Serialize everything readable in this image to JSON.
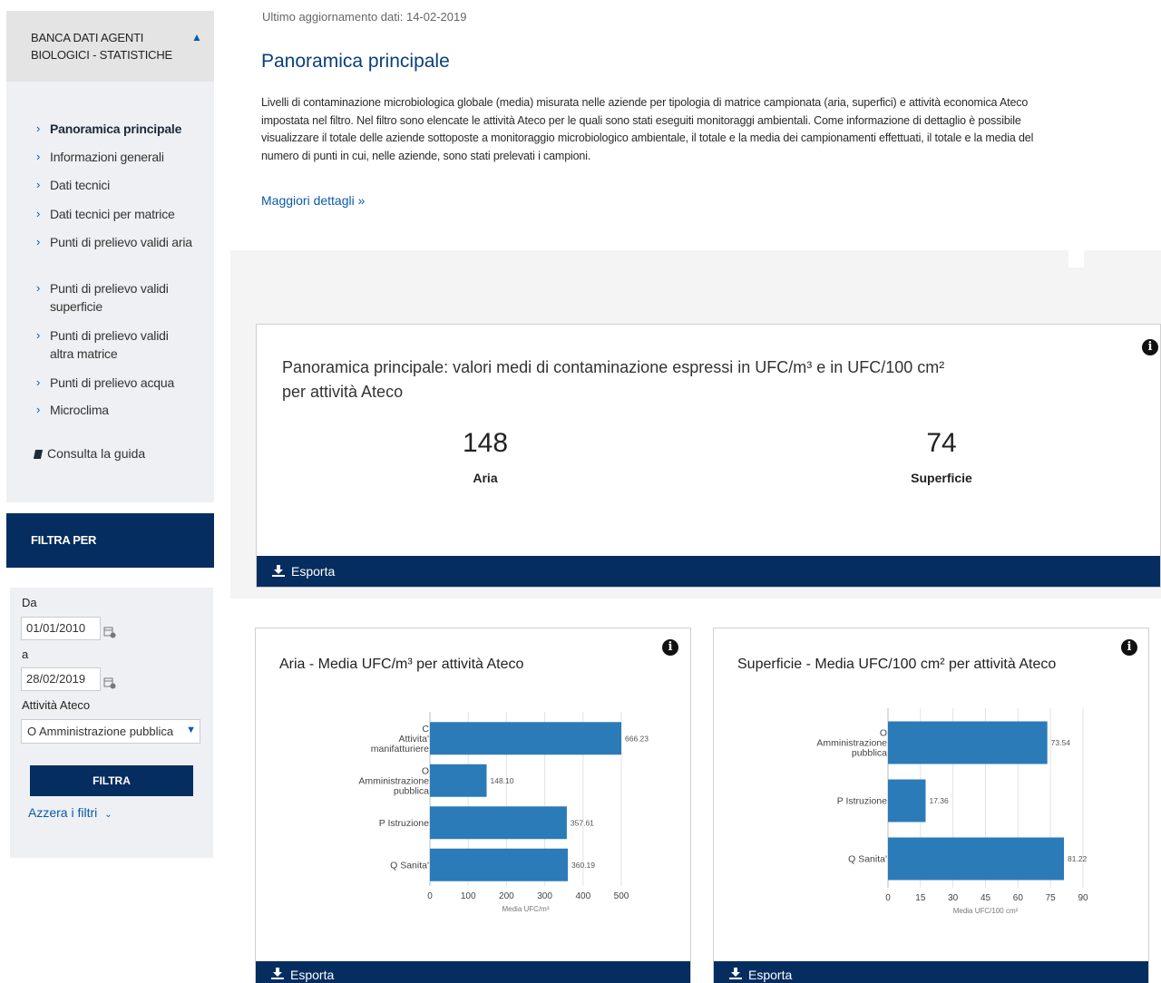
{
  "sidebar": {
    "title": "BANCA DATI AGENTI BIOLOGICI - STATISTICHE",
    "items": [
      {
        "label": "Panoramica principale"
      },
      {
        "label": "Informazioni generali"
      },
      {
        "label": "Dati tecnici"
      },
      {
        "label": "Dati tecnici per matrice"
      },
      {
        "label": "Punti di prelievo validi aria"
      },
      {
        "label": "Punti di prelievo validi superficie"
      },
      {
        "label": "Punti di prelievo validi altra matrice"
      },
      {
        "label": "Punti di prelievo acqua"
      },
      {
        "label": "Microclima"
      }
    ],
    "guide_label": "Consulta la guida"
  },
  "filter": {
    "title": "FILTRA PER",
    "from_label": "Da",
    "from_value": "01/01/2010",
    "to_label": "a",
    "to_value": "28/02/2019",
    "ateco_label": "Attività Ateco",
    "ateco_value": "O Amministrazione pubblica",
    "button_label": "FILTRA",
    "reset_label": "Azzera i filtri"
  },
  "main": {
    "updated": "Ultimo aggiornamento dati: 14-02-2019",
    "title": "Panoramica principale",
    "intro": "Livelli di contaminazione microbiologica globale (media) misurata nelle aziende per tipologia di matrice campionata (aria, superfici) e attività economica Ateco impostata nel filtro. Nel filtro sono elencate le attività Ateco per le quali sono stati eseguiti monitoraggi ambientali. Come informazione di dettaglio è possibile visualizzare il totale delle aziende sottoposte a monitoraggio microbiologico ambientale, il totale e la media dei campionamenti effettuati, il totale e la media del numero di punti in cui, nelle aziende, sono stati prelevati i campioni.",
    "more_label": "Maggiori dettagli »"
  },
  "summary_card": {
    "title": "Panoramica principale: valori medi di contaminazione espressi in UFC/m³ e in UFC/100 cm² per attività Ateco",
    "kpis": [
      {
        "value": "148",
        "label": "Aria"
      },
      {
        "value": "74",
        "label": "Superficie"
      }
    ],
    "export_label": "Esporta"
  },
  "chart_data": [
    {
      "type": "bar",
      "orientation": "horizontal",
      "title": "Aria - Media UFC/m³ per attività Ateco",
      "categories": [
        "C Attivita' manifatturiere",
        "O Amministrazione pubblica",
        "P Istruzione",
        "Q Sanita'"
      ],
      "values": [
        666.23,
        148.1,
        357.61,
        360.19
      ],
      "value_labels": [
        "666.23",
        "148.10",
        "357.61",
        "360.19"
      ],
      "xlabel": "Media UFC/m³",
      "xticks": [
        0,
        100,
        200,
        300,
        400,
        500
      ],
      "xlim": [
        0,
        500
      ],
      "color": "#2b7bb9",
      "export_label": "Esporta"
    },
    {
      "type": "bar",
      "orientation": "horizontal",
      "title": "Superficie - Media UFC/100 cm² per attività Ateco",
      "categories": [
        "O Amministrazione pubblica",
        "P Istruzione",
        "Q Sanita'"
      ],
      "values": [
        73.54,
        17.36,
        81.22
      ],
      "value_labels": [
        "73.54",
        "17.36",
        "81.22"
      ],
      "xlabel": "Media UFC/100 cm²",
      "xticks": [
        0,
        15,
        30,
        45,
        60,
        75,
        90
      ],
      "xlim": [
        0,
        90
      ],
      "color": "#2b7bb9",
      "export_label": "Esporta"
    }
  ]
}
